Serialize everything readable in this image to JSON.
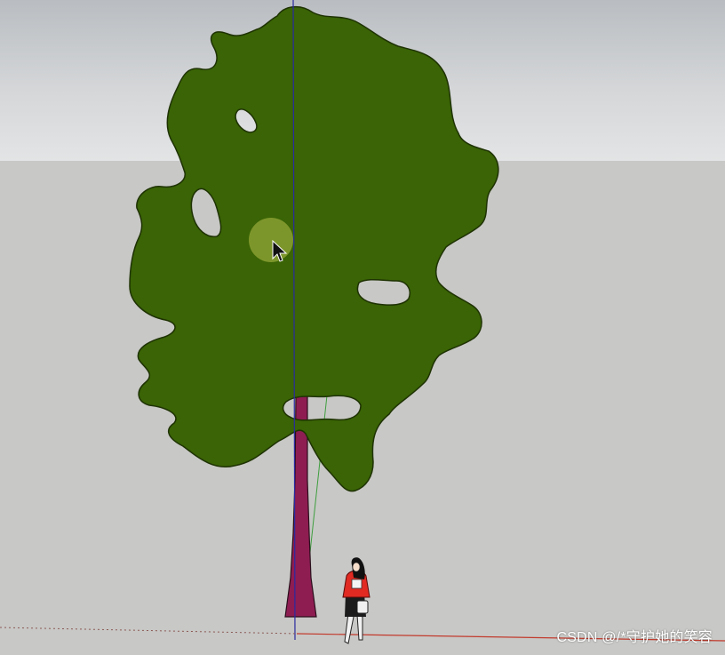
{
  "watermark": {
    "text": "CSDN @/*守护她的笑容"
  },
  "colors": {
    "canopy": "#3a6405",
    "trunk": "#8e1d52",
    "sky": "#d4d6d8",
    "ground": "#c8c8c6",
    "axis_blue": "#2a2aa0",
    "axis_green": "#3e9e3e",
    "axis_red": "#c23a2c"
  },
  "icons": {
    "cursor": "arrow-cursor-icon",
    "person": "scale-figure-icon"
  }
}
